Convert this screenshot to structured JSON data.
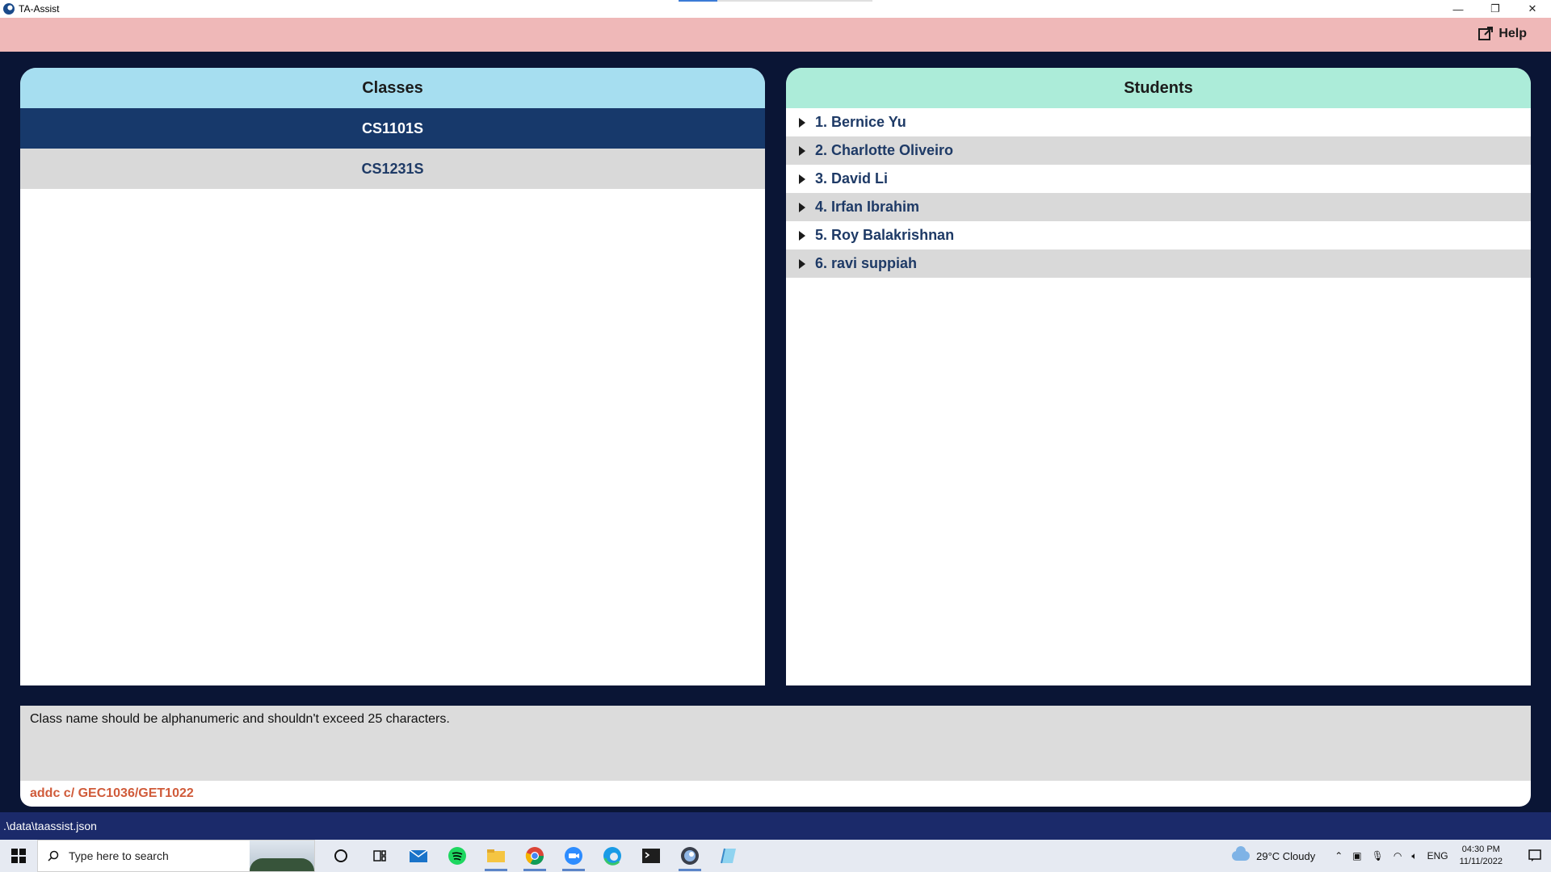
{
  "window": {
    "title": "TA-Assist",
    "minimize": "—",
    "restore": "❐",
    "close": "✕"
  },
  "menubar": {
    "help_label": "Help"
  },
  "classes_panel": {
    "title": "Classes",
    "items": [
      {
        "label": "CS1101S",
        "selected": true
      },
      {
        "label": "CS1231S",
        "selected": false
      }
    ]
  },
  "students_panel": {
    "title": "Students",
    "items": [
      {
        "label": "1. Bernice Yu"
      },
      {
        "label": "2. Charlotte Oliveiro"
      },
      {
        "label": "3. David Li"
      },
      {
        "label": "4. Irfan Ibrahim"
      },
      {
        "label": "5. Roy Balakrishnan"
      },
      {
        "label": "6. ravi suppiah"
      }
    ]
  },
  "result_display": {
    "text": "Class name should be alphanumeric and shouldn't exceed 25 characters."
  },
  "command_box": {
    "value": "addc c/ GEC1036/GET1022"
  },
  "status_bar": {
    "path": ".\\data\\taassist.json"
  },
  "taskbar": {
    "search_placeholder": "Type here to search",
    "apps": [
      "cortana-icon",
      "task-view-icon",
      "mail-icon",
      "spotify-icon",
      "file-explorer-icon",
      "chrome-icon",
      "zoom-icon",
      "edge-icon",
      "terminal-icon",
      "java-app-icon",
      "notes-icon"
    ],
    "weather": "29°C  Cloudy",
    "language": "ENG",
    "time": "04:30 PM",
    "date": "11/11/2022"
  },
  "colors": {
    "menubar": "#efb8b8",
    "classes_header": "#a6def0",
    "students_header": "#acecd9",
    "selected_class": "#17396b",
    "background": "#0a1535",
    "command_text": "#d05b3a"
  }
}
